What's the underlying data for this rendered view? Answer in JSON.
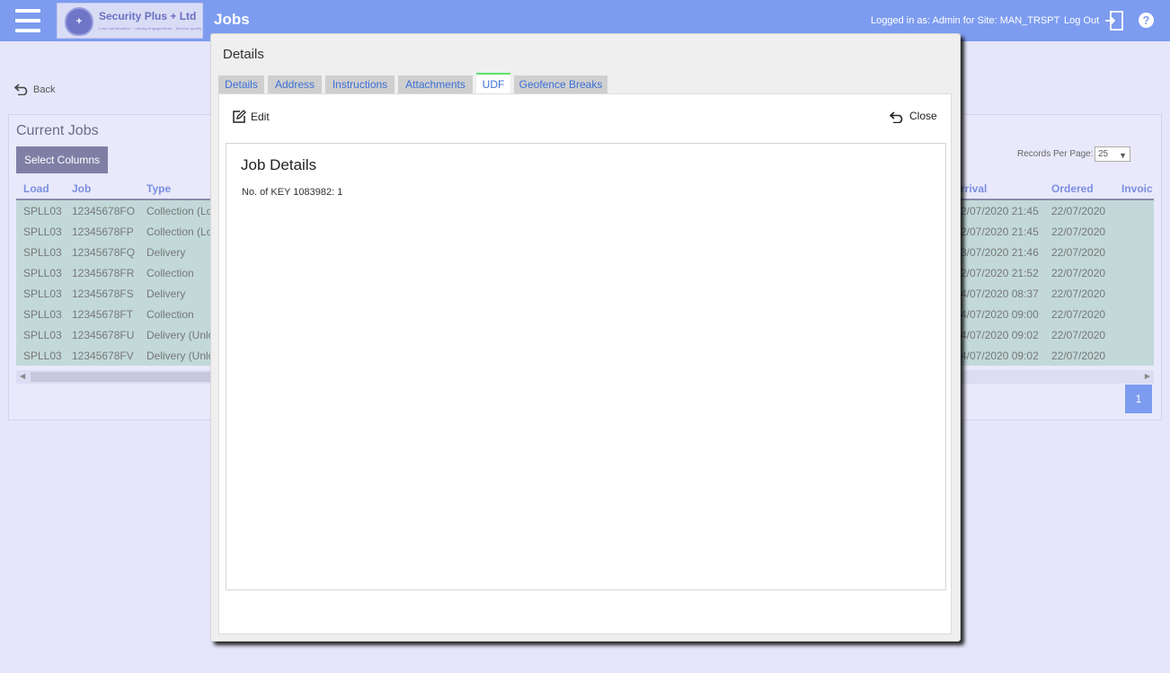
{
  "header": {
    "company_name": "Security Plus + Ltd",
    "logo_badge": "+",
    "logo_tagline": "Loss minimisation · Lasting engagements · Service quality",
    "page_title": "Jobs",
    "logged_in": "Logged in as: Admin for Site: MAN_TRSPT",
    "logout": "Log Out",
    "help": "?"
  },
  "nav": {
    "back": "Back"
  },
  "jobs": {
    "title": "Current Jobs",
    "select_columns": "Select Columns",
    "records_per_page_label": "Records Per Page:",
    "records_per_page_value": "25",
    "columns": {
      "load": "Load",
      "job": "Job",
      "type": "Type",
      "arrival": "rrival",
      "ordered": "Ordered",
      "invoice": "Invoic"
    },
    "rows": [
      {
        "load": "SPLL03",
        "job": "12345678FO",
        "type": "Collection (Lo",
        "arrival": "2/07/2020 21:45",
        "ordered": "22/07/2020"
      },
      {
        "load": "SPLL03",
        "job": "12345678FP",
        "type": "Collection (Lo",
        "arrival": "2/07/2020 21:45",
        "ordered": "22/07/2020"
      },
      {
        "load": "SPLL03",
        "job": "12345678FQ",
        "type": "Delivery",
        "arrival": "3/07/2020 21:46",
        "ordered": "22/07/2020"
      },
      {
        "load": "SPLL03",
        "job": "12345678FR",
        "type": "Collection",
        "arrival": "2/07/2020 21:52",
        "ordered": "22/07/2020"
      },
      {
        "load": "SPLL03",
        "job": "12345678FS",
        "type": "Delivery",
        "arrival": "4/07/2020 08:37",
        "ordered": "22/07/2020"
      },
      {
        "load": "SPLL03",
        "job": "12345678FT",
        "type": "Collection",
        "arrival": "4/07/2020 09:00",
        "ordered": "22/07/2020"
      },
      {
        "load": "SPLL03",
        "job": "12345678FU",
        "type": "Delivery (Unlo",
        "arrival": "4/07/2020 09:02",
        "ordered": "22/07/2020"
      },
      {
        "load": "SPLL03",
        "job": "12345678FV",
        "type": "Delivery (Unlo",
        "arrival": "4/07/2020 09:02",
        "ordered": "22/07/2020"
      }
    ],
    "page_number": "1"
  },
  "modal": {
    "title": "Details",
    "tabs": [
      {
        "label": "Details"
      },
      {
        "label": "Address"
      },
      {
        "label": "Instructions"
      },
      {
        "label": "Attachments"
      },
      {
        "label": "UDF"
      },
      {
        "label": "Geofence Breaks"
      }
    ],
    "active_tab": "UDF",
    "edit": "Edit",
    "close": "Close",
    "section_title": "Job Details",
    "fields": [
      {
        "text": "No. of KEY 1083982: 1"
      }
    ]
  },
  "colors": {
    "header_bg": "#7d9cf0",
    "page_bg": "#e6e6fb",
    "row_bg": "#c3d9d9",
    "tab_link": "#3b6fd6",
    "active_tab_accent": "#5fe06a"
  }
}
